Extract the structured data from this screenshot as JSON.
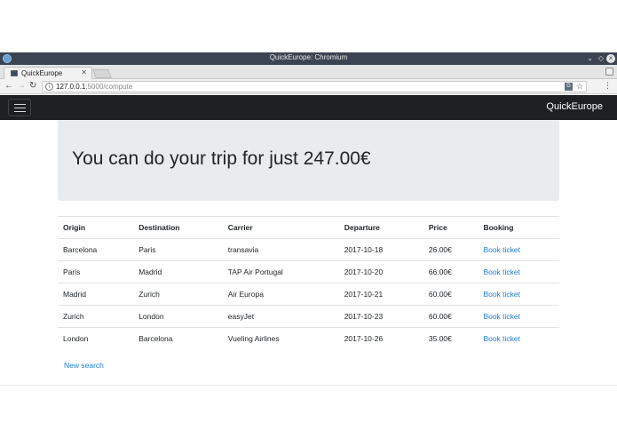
{
  "browser": {
    "window_title": "QuickEurope: Chromium",
    "tab_label": "QuickEurope",
    "url_host": "127.0.0.1",
    "url_path": ":5000/compute"
  },
  "navbar": {
    "brand": "QuickEurope"
  },
  "jumbotron": {
    "headline": "You can do your trip for just 247.00€"
  },
  "table": {
    "headers": [
      "Origin",
      "Destination",
      "Carrier",
      "Departure",
      "Price",
      "Booking"
    ],
    "rows": [
      [
        "Barcelona",
        "Paris",
        "transavia",
        "2017-10-18",
        "26.00€",
        "Book ticket"
      ],
      [
        "Paris",
        "Madrid",
        "TAP Air Portugal",
        "2017-10-20",
        "66.00€",
        "Book ticket"
      ],
      [
        "Madrid",
        "Zurich",
        "Air Europa",
        "2017-10-21",
        "60.00€",
        "Book ticket"
      ],
      [
        "Zurich",
        "London",
        "easyJet",
        "2017-10-23",
        "60.00€",
        "Book ticket"
      ],
      [
        "London",
        "Barcelona",
        "Vueling Airlines",
        "2017-10-26",
        "35.00€",
        "Book ticket"
      ]
    ]
  },
  "new_search_label": "New search",
  "colors": {
    "navbar_bg": "#1d1f23",
    "jumbotron_bg": "#e9ecef",
    "link": "#1a7fdb"
  }
}
